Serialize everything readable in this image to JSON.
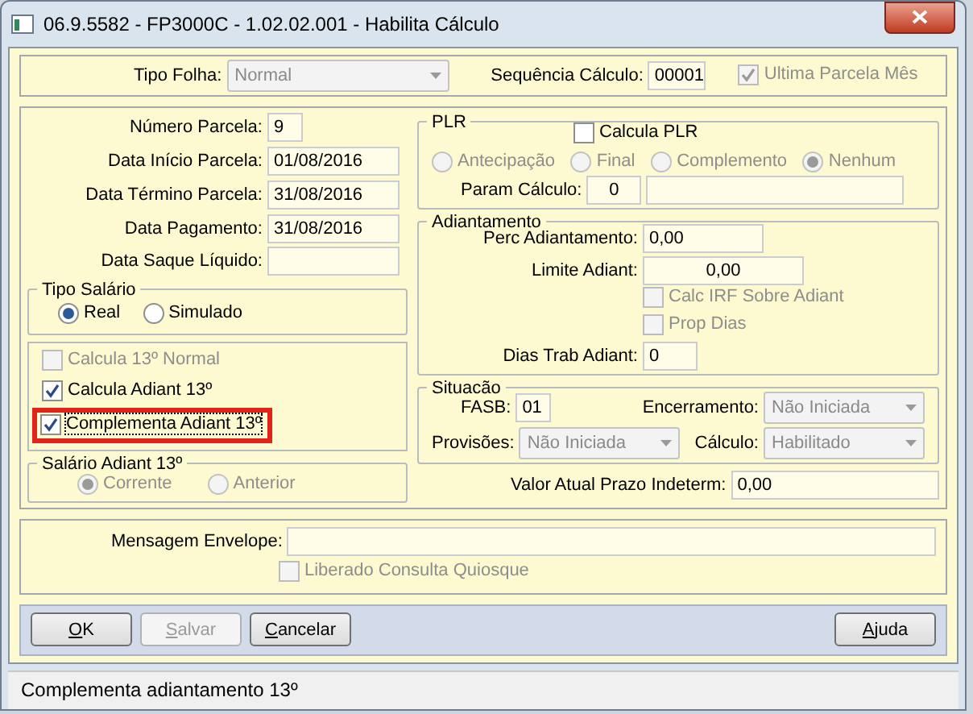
{
  "window": {
    "title": "06.9.5582 - FP3000C - 1.02.02.001 - Habilita Cálculo"
  },
  "header": {
    "tipo_folha": {
      "label": "Tipo Folha:",
      "value": "Normal",
      "disabled": true
    },
    "sequencia": {
      "label": "Sequência Cálculo:",
      "value": "00001"
    },
    "ultima_parcela": {
      "label": "Ultima Parcela Mês",
      "checked": true,
      "disabled": true
    }
  },
  "parcela_fields": [
    {
      "label": "Número Parcela:",
      "value": "9",
      "kind": "short"
    },
    {
      "label": "Data Início Parcela:",
      "value": "01/08/2016",
      "kind": "date"
    },
    {
      "label": "Data Término Parcela:",
      "value": "31/08/2016",
      "kind": "date"
    },
    {
      "label": "Data Pagamento:",
      "value": "31/08/2016",
      "kind": "date"
    },
    {
      "label": "Data Saque Líquido:",
      "kind": "date"
    }
  ],
  "tipo_salario": {
    "title": "Tipo Salário",
    "options": [
      {
        "label": "Real",
        "selected": true,
        "disabled": false
      },
      {
        "label": "Simulado",
        "selected": false,
        "disabled": false
      }
    ]
  },
  "calc_checks": [
    {
      "label": "Calcula 13º Normal",
      "checked": false,
      "disabled": true,
      "highlighted": false
    },
    {
      "label": "Calcula Adiant 13º",
      "checked": true,
      "disabled": false,
      "highlighted": false
    },
    {
      "label": "Complementa Adiant 13º",
      "checked": true,
      "disabled": false,
      "highlighted": true
    }
  ],
  "salario_adiant": {
    "title": "Salário Adiant 13º",
    "options": [
      {
        "label": "Corrente",
        "selected": true,
        "disabled": true
      },
      {
        "label": "Anterior",
        "selected": false,
        "disabled": true
      }
    ]
  },
  "plr": {
    "title": "PLR",
    "calcula": {
      "label": "Calcula PLR",
      "checked": false,
      "disabled": false
    },
    "options": [
      {
        "label": "Antecipação",
        "selected": false,
        "disabled": true
      },
      {
        "label": "Final",
        "selected": false,
        "disabled": true
      },
      {
        "label": "Complemento",
        "selected": false,
        "disabled": true
      },
      {
        "label": "Nenhum",
        "selected": true,
        "disabled": true
      }
    ],
    "param": {
      "label": "Param Cálculo:",
      "value": "0"
    }
  },
  "adiantamento": {
    "title": "Adiantamento",
    "perc": {
      "label": "Perc Adiantamento:",
      "value": "0,00"
    },
    "limite": {
      "label": "Limite Adiant:",
      "value": "0,00"
    },
    "checks": [
      {
        "label": "Calc IRF Sobre Adiant",
        "checked": false,
        "disabled": true
      },
      {
        "label": "Prop Dias",
        "checked": false,
        "disabled": true
      }
    ],
    "dias": {
      "label": "Dias Trab Adiant:",
      "value": "0"
    }
  },
  "situacao": {
    "title": "Situacão",
    "fasb": {
      "label": "FASB:",
      "value": "01"
    },
    "encerramento": {
      "label": "Encerramento:",
      "value": "Não Iniciada",
      "disabled": true
    },
    "provisoes": {
      "label": "Provisões:",
      "value": "Não Iniciada",
      "disabled": true
    },
    "calculo": {
      "label": "Cálculo:",
      "value": "Habilitado",
      "disabled": true
    }
  },
  "valor_atual": {
    "label": "Valor Atual Prazo Indeterm:",
    "value": "0,00"
  },
  "mensagem": {
    "label": "Mensagem Envelope:"
  },
  "liberado": {
    "label": "Liberado Consulta Quiosque",
    "checked": false,
    "disabled": true
  },
  "buttons": [
    {
      "label": "OK",
      "disabled": false
    },
    {
      "label": "Salvar",
      "disabled": true
    },
    {
      "label": "Cancelar",
      "disabled": false
    },
    {
      "label": "Ajuda",
      "disabled": false
    }
  ],
  "status_bar": "Complementa adiantamento 13º"
}
